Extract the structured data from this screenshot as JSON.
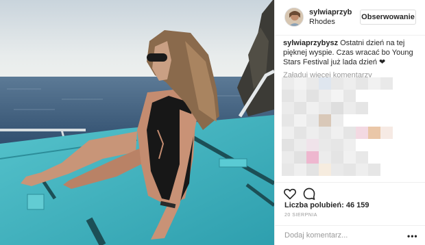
{
  "post": {
    "username": "sylwiaprzybysz",
    "location": "Rhodes",
    "follow_label": "Obserwowanie"
  },
  "caption": {
    "username": "sylwiaprzybysz",
    "text": "Ostatni dzień na tej pięknej wyspie. Czas wracać bo Young Stars Festival już lada dzień ❤"
  },
  "comments": {
    "load_more": "Załaduj więcej komentarzy",
    "blurred": true
  },
  "footer": {
    "likes": "Liczba polubień: 46 159",
    "date": "20 SIERPNIA",
    "add_comment_placeholder": "Dodaj komentarz...",
    "more_icon": "•••"
  },
  "icons": {
    "like": "heart-icon",
    "comment": "comment-bubble-icon",
    "more": "more-options-icon"
  },
  "colors": {
    "boat_deck": "#3fb1bd",
    "sea": "#3a5a7c",
    "sky": "#dfe6ea",
    "follow_border": "#dbdbdb",
    "muted_text": "#999999"
  }
}
